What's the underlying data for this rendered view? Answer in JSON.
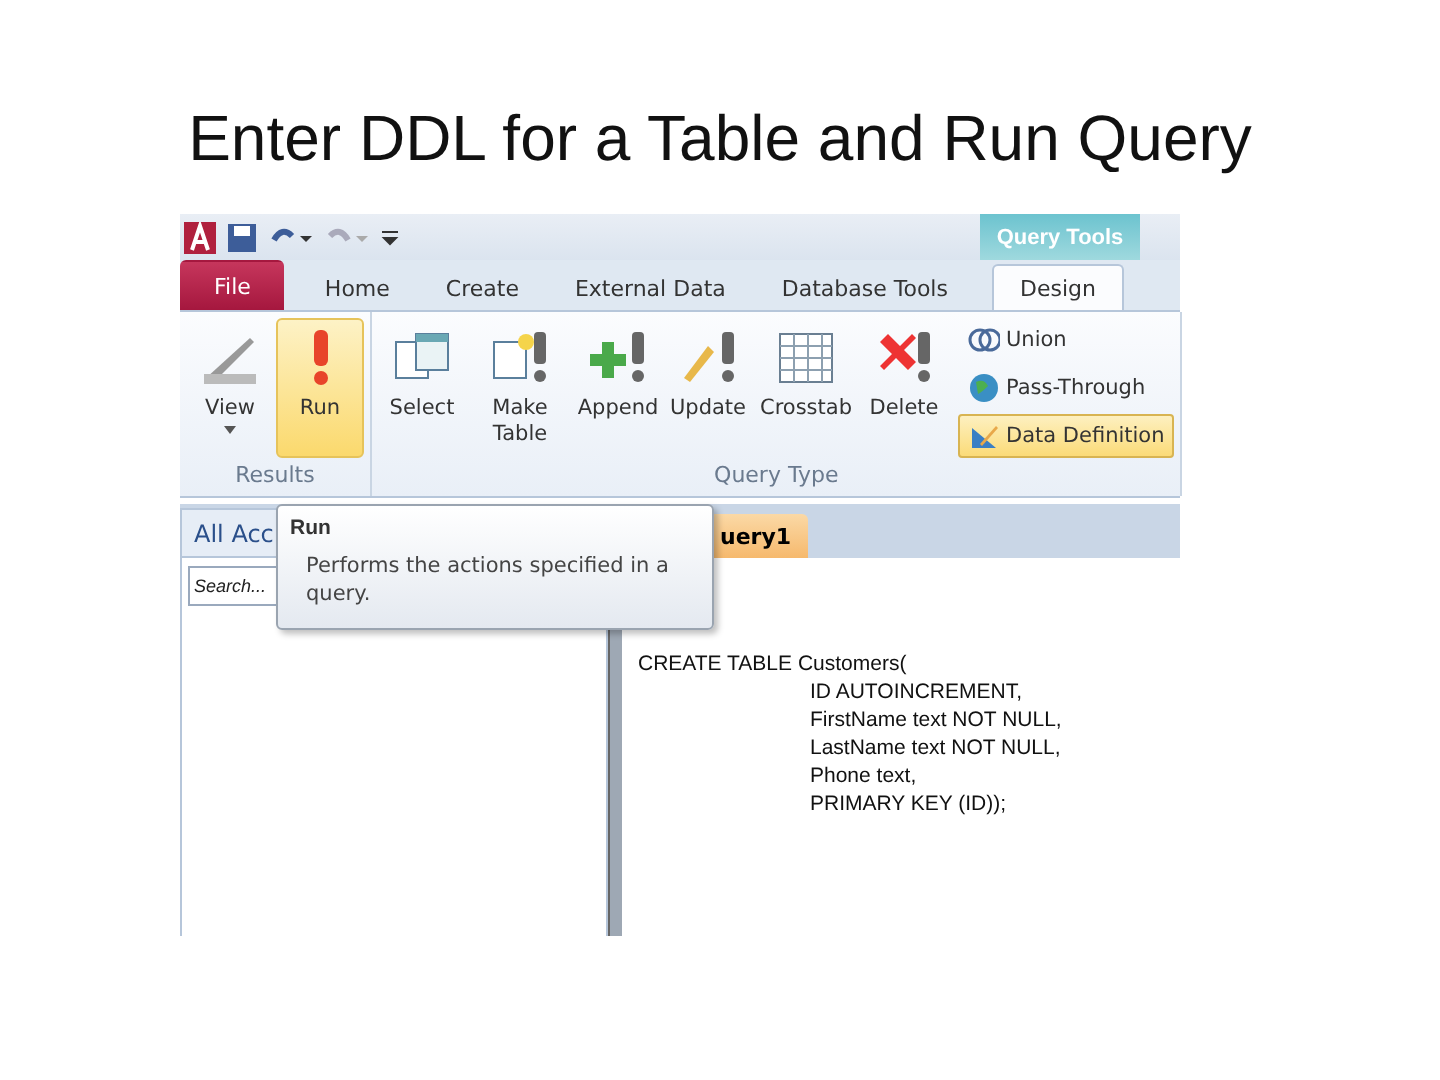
{
  "slide_title": "Enter DDL for a Table and Run Query",
  "ribbon_tabs": [
    {
      "label": "File",
      "kind": "file",
      "selected": false
    },
    {
      "label": "Home",
      "kind": "tab",
      "selected": false
    },
    {
      "label": "Create",
      "kind": "tab",
      "selected": false
    },
    {
      "label": "External Data",
      "kind": "tab",
      "selected": false
    },
    {
      "label": "Database Tools",
      "kind": "tab",
      "selected": false
    },
    {
      "label": "Design",
      "kind": "tab",
      "selected": true
    }
  ],
  "context_tab": "Query Tools",
  "groups": [
    {
      "label": "Results",
      "buttons": [
        {
          "label": "View",
          "dropdown": true,
          "highlighted": false
        },
        {
          "label": "Run",
          "dropdown": false,
          "highlighted": true
        }
      ]
    },
    {
      "label": "Query Type",
      "buttons": [
        {
          "label": "Select",
          "dropdown": false,
          "highlighted": false
        },
        {
          "label": "Make Table",
          "dropdown": false,
          "highlighted": false
        },
        {
          "label": "Append",
          "dropdown": false,
          "highlighted": false
        },
        {
          "label": "Update",
          "dropdown": false,
          "highlighted": false
        },
        {
          "label": "Crosstab",
          "dropdown": false,
          "highlighted": false
        },
        {
          "label": "Delete",
          "dropdown": false,
          "highlighted": false
        }
      ],
      "small_buttons": [
        {
          "label": "Union",
          "selected": false
        },
        {
          "label": "Pass-Through",
          "selected": false
        },
        {
          "label": "Data Definition",
          "selected": true
        }
      ]
    }
  ],
  "nav_pane": {
    "header": "All Acc",
    "search": {
      "placeholder": "Search..."
    }
  },
  "document_tab": "uery1",
  "tooltip": {
    "title": "Run",
    "text": "Performs the actions specified in a query."
  },
  "editor_lines": [
    {
      "text": "CREATE TABLE Customers(",
      "indented": false
    },
    {
      "text": "ID AUTOINCREMENT,",
      "indented": true
    },
    {
      "text": "FirstName text NOT NULL,",
      "indented": true
    },
    {
      "text": "LastName text NOT NULL,",
      "indented": true
    },
    {
      "text": "Phone text,",
      "indented": true
    },
    {
      "text": "PRIMARY KEY (ID));",
      "indented": true
    }
  ]
}
